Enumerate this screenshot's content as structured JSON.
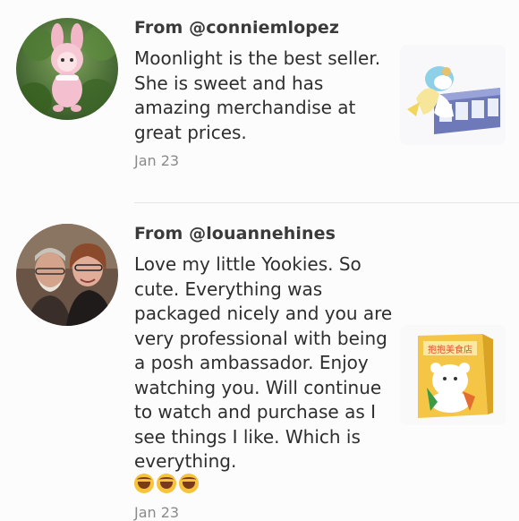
{
  "reviews": [
    {
      "from": "From @conniemlopez",
      "text": "Moonlight is the best seller. She is sweet and has amazing merchandise at great prices.",
      "date": "Jan 23",
      "avatar_icon": "pink-plush-doll-avatar",
      "thumb_icon": "blind-box-figures-thumbnail"
    },
    {
      "from": "From @louannehines",
      "text": "Love my little Yookies. So cute. Everything was packaged nicely and you are very professional with being a posh ambassador. Enjoy watching you. Will continue to watch and purchase as I see things I like. Which is everything.",
      "emoji": [
        "🤣",
        "🤣",
        "🤣"
      ],
      "date": "Jan 23",
      "avatar_icon": "couple-photo-avatar",
      "thumb_icon": "yellow-product-box-thumbnail",
      "thumb_label": "抱抱美食店"
    }
  ]
}
